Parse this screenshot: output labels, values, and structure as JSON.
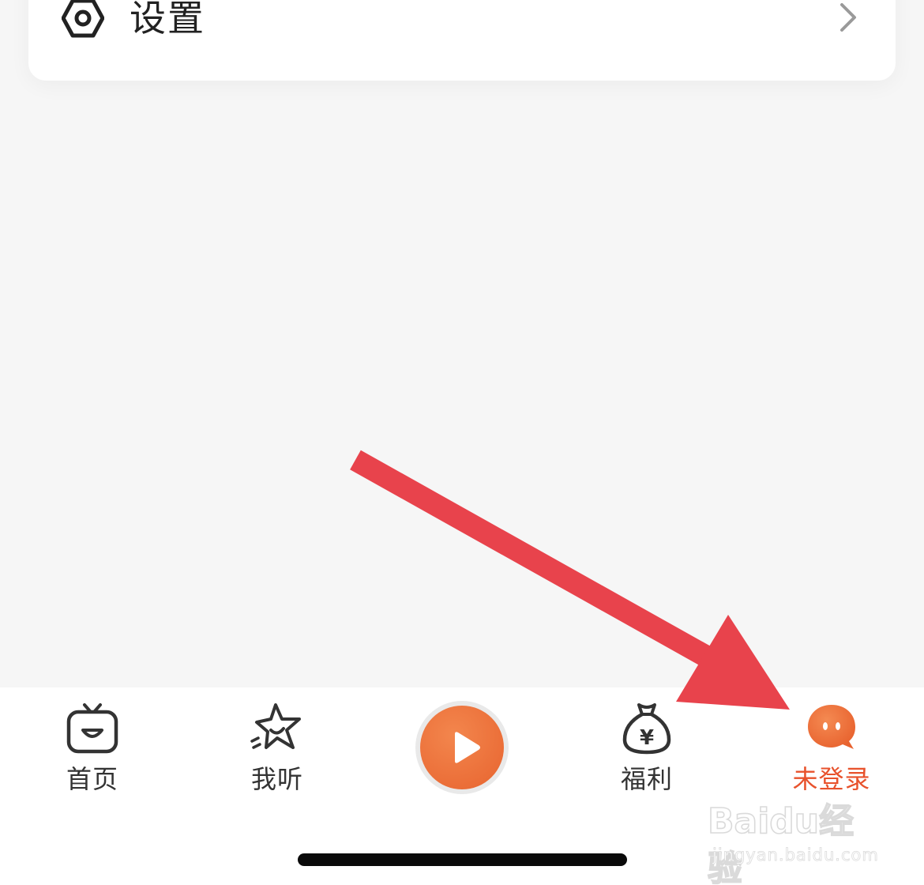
{
  "settings": {
    "label": "设置",
    "icon": "gear-icon",
    "chevron": "chevron-right-icon"
  },
  "tab_bar": {
    "tabs": [
      {
        "label": "首页",
        "icon": "tv-face-icon",
        "active": false
      },
      {
        "label": "我听",
        "icon": "star-icon",
        "active": false
      },
      {
        "label": "福利",
        "icon": "money-bag-icon",
        "active": false
      },
      {
        "label": "未登录",
        "icon": "chat-avatar-icon",
        "active": true
      }
    ],
    "play_icon": "play-icon"
  },
  "watermark": {
    "logo": "Baidu经验",
    "url": "jingyan.baidu.com"
  },
  "colors": {
    "accent": "#e8522c",
    "orange": "#eb6e38",
    "arrow": "#e8434c",
    "background": "#f6f6f6"
  }
}
